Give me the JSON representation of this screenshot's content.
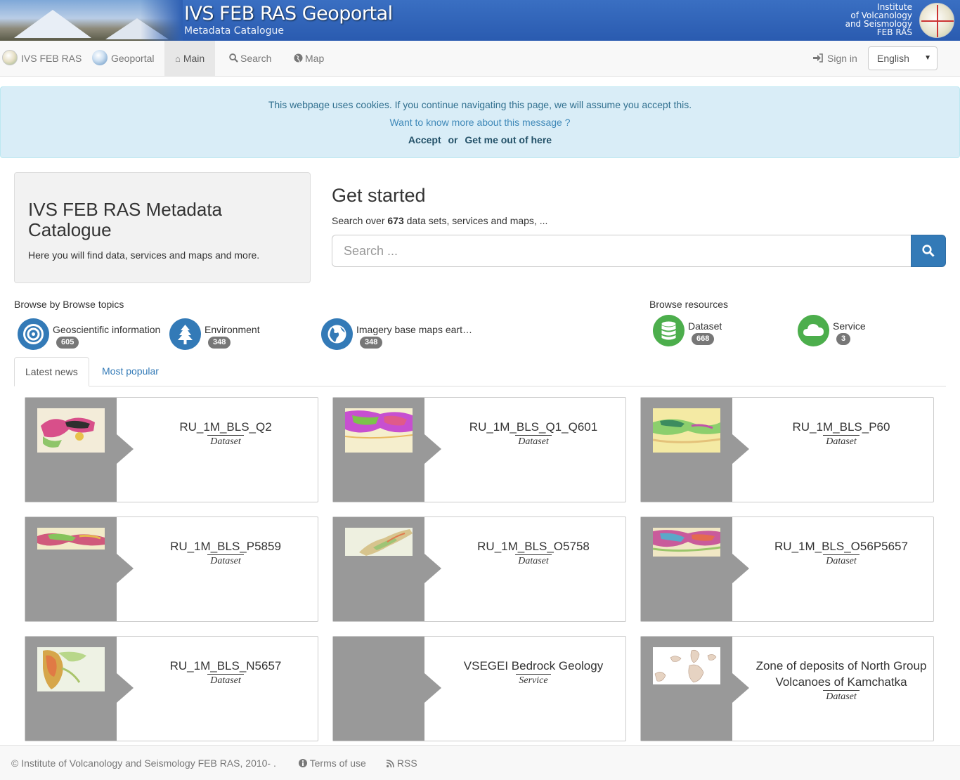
{
  "banner": {
    "title": "IVS FEB RAS Geoportal",
    "subtitle": "Metadata Catalogue",
    "institute_lines": [
      "Institute",
      "of Volcanology",
      "and Seismology",
      "FEB RAS"
    ]
  },
  "navbar": {
    "brand1": "IVS FEB RAS",
    "brand2": "Geoportal",
    "main": "Main",
    "search": "Search",
    "map": "Map",
    "signin": "Sign in",
    "language": "English"
  },
  "cookie": {
    "message": "This webpage uses cookies. If you continue navigating this page, we will assume you accept this.",
    "more": "Want to know more about this message ?",
    "accept": "Accept",
    "or": "or",
    "leave": "Get me out of here"
  },
  "jumbotron": {
    "title": "IVS FEB RAS Metadata Catalogue",
    "text": "Here you will find data, services and maps and more."
  },
  "get_started": {
    "title": "Get started",
    "prefix": "Search over",
    "count": "673",
    "suffix": "data sets, services and maps, ...",
    "placeholder": "Search ..."
  },
  "browse_topics": {
    "heading": "Browse by Browse topics",
    "items": [
      {
        "label": "Geoscientific information",
        "count": "605",
        "icon": "target-icon"
      },
      {
        "label": "Environment",
        "count": "348",
        "icon": "tree-icon"
      },
      {
        "label": "Imagery base maps earth cover",
        "count": "348",
        "icon": "globe-icon"
      }
    ]
  },
  "browse_resources": {
    "heading": "Browse resources",
    "items": [
      {
        "label": "Dataset",
        "count": "668",
        "icon": "database-icon"
      },
      {
        "label": "Service",
        "count": "3",
        "icon": "cloud-icon"
      }
    ]
  },
  "tabs": {
    "latest": "Latest news",
    "popular": "Most popular"
  },
  "cards": [
    {
      "title": "RU_1M_BLS_Q2",
      "type": "Dataset"
    },
    {
      "title": "RU_1M_BLS_Q1_Q601",
      "type": "Dataset"
    },
    {
      "title": "RU_1M_BLS_P60",
      "type": "Dataset"
    },
    {
      "title": "RU_1M_BLS_P5859",
      "type": "Dataset"
    },
    {
      "title": "RU_1M_BLS_O5758",
      "type": "Dataset"
    },
    {
      "title": "RU_1M_BLS_O56P5657",
      "type": "Dataset"
    },
    {
      "title": "RU_1M_BLS_N5657",
      "type": "Dataset"
    },
    {
      "title": "VSEGEI Bedrock Geology",
      "type": "Service"
    },
    {
      "title": "Zone of deposits of North Group Volcanoes of Kamchatka",
      "type": "Dataset"
    }
  ],
  "footer": {
    "copyright": "Institute of Volcanology and Seismology FEB RAS, 2010- .",
    "terms": "Terms of use",
    "rss": "RSS"
  },
  "colors": {
    "primary": "#337ab7",
    "success": "#4cae4c",
    "badge": "#777777",
    "alert_bg": "#d9edf7"
  }
}
